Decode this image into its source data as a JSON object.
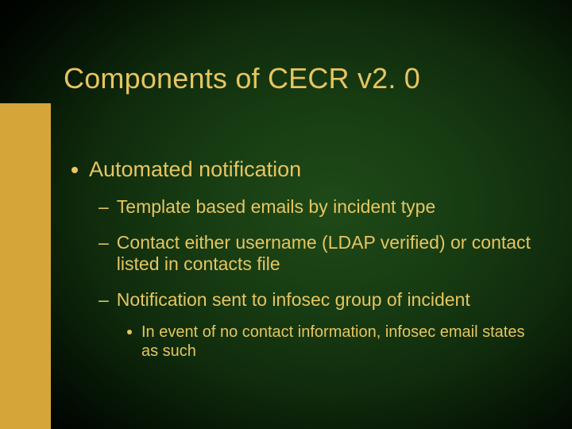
{
  "title": "Components of CECR v2. 0",
  "bullets": {
    "lvl1": "Automated notification",
    "lvl2": [
      "Template based emails by incident type",
      "Contact either username (LDAP verified) or contact listed in contacts file",
      "Notification sent to infosec group of incident"
    ],
    "lvl3": "In event of no contact information, infosec email states as such"
  }
}
